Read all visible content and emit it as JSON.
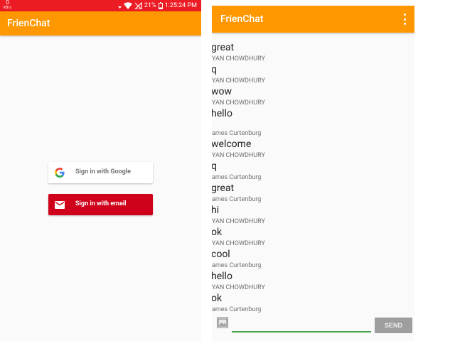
{
  "status_bar": {
    "speed_value": "0",
    "speed_unit": "KB/s",
    "battery": "21%",
    "time": "1:25:24 PM",
    "color": "#ec1c24"
  },
  "login_screen": {
    "app_title": "FrienChat",
    "google_button_label": "Sign in with Google",
    "email_button_label": "Sign in with email",
    "google_icon": "google-g-icon",
    "email_icon": "envelope-icon"
  },
  "chat_screen": {
    "app_title": "FrienChat",
    "menu_icon": "overflow-menu-icon",
    "messages": [
      {
        "text": "great",
        "name": "YAN CHOWDHURY"
      },
      {
        "text": "q",
        "name": "YAN CHOWDHURY"
      },
      {
        "text": "wow",
        "name": "YAN CHOWDHURY"
      },
      {
        "text": "hello",
        "name": "ames Curtenburg"
      },
      {
        "text": "welcome",
        "name": "YAN CHOWDHURY"
      },
      {
        "text": "q",
        "name": "ames Curtenburg"
      },
      {
        "text": "great",
        "name": "ames Curtenburg"
      },
      {
        "text": "hi",
        "name": "YAN CHOWDHURY"
      },
      {
        "text": "ok",
        "name": "YAN CHOWDHURY"
      },
      {
        "text": "cool",
        "name": "ames Curtenburg"
      },
      {
        "text": "hello",
        "name": "YAN CHOWDHURY"
      },
      {
        "text": "ok",
        "name": "ames Curtenburg"
      }
    ],
    "input_placeholder": "",
    "photo_icon": "image-icon",
    "send_label": "SEND"
  },
  "colors": {
    "app_bar": "#ff9800",
    "email_button": "#d0021b",
    "input_underline": "#43a047",
    "send_button": "#9e9e9e"
  }
}
